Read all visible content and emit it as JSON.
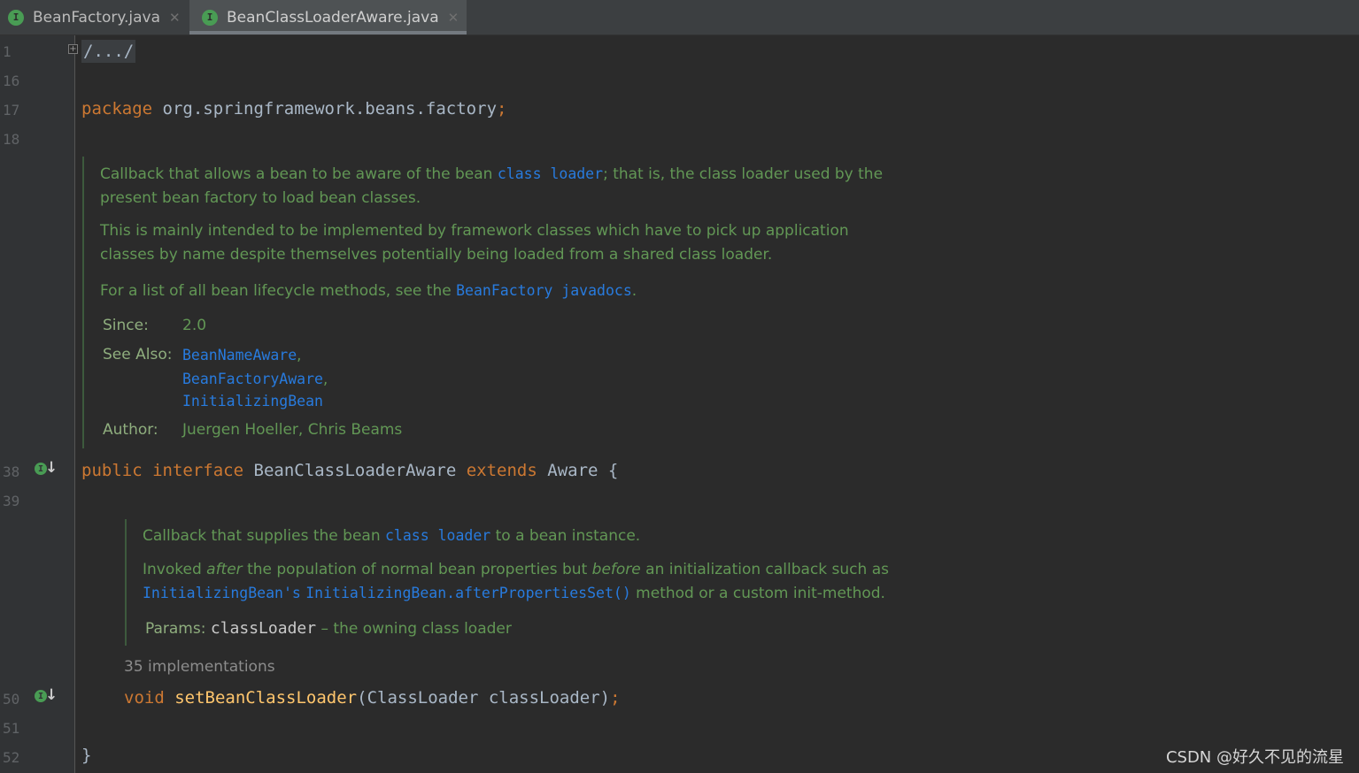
{
  "tabs": [
    {
      "label": "BeanFactory.java",
      "icon": "interface-icon",
      "active": false
    },
    {
      "label": "BeanClassLoaderAware.java",
      "icon": "interface-icon",
      "active": true
    }
  ],
  "gutter": {
    "line_numbers": [
      "1",
      "16",
      "17",
      "18",
      "38",
      "39",
      "50",
      "51",
      "52"
    ]
  },
  "code": {
    "collapsed_header": "/.../",
    "package_keyword": "package",
    "package_name": " org.springframework.beans.factory",
    "package_semicolon": ";",
    "interface_decl": {
      "kw_public": "public",
      "kw_interface": "interface",
      "name": "BeanClassLoaderAware",
      "kw_extends": "extends",
      "parent": "Aware",
      "brace": "{"
    },
    "method_decl": {
      "kw_void": "void",
      "name": "setBeanClassLoader",
      "params": "(ClassLoader classLoader)",
      "semicolon": ";"
    },
    "closing_brace": "}",
    "implementations_hint": "35 implementations"
  },
  "class_doc": {
    "p1_a": "Callback that allows a bean to be aware of the bean ",
    "p1_link": "class loader",
    "p1_b": "; that is, the class loader used by the",
    "p1_line2": "present bean factory to load bean classes.",
    "p2_line1": "This is mainly intended to be implemented by framework classes which have to pick up application",
    "p2_line2": "classes by name despite themselves potentially being loaded from a shared class loader.",
    "p3_a": "For a list of all bean lifecycle methods, see the ",
    "p3_link": "BeanFactory javadocs",
    "p3_b": ".",
    "since_label": "Since:",
    "since_value": "2.0",
    "see_also_label": "See Also:",
    "see_also": [
      "BeanNameAware",
      "BeanFactoryAware",
      "InitializingBean"
    ],
    "see_also_sep": ",",
    "author_label": "Author:",
    "author_value": "Juergen Hoeller, Chris Beams"
  },
  "method_doc": {
    "p1_a": "Callback that supplies the bean ",
    "p1_link": "class loader",
    "p1_b": " to a bean instance.",
    "p2_a": "Invoked ",
    "p2_em1": "after",
    "p2_b": " the population of normal bean properties but ",
    "p2_em2": "before",
    "p2_c": " an initialization callback such as",
    "p2_link1": "InitializingBean's",
    "p2_link2": "InitializingBean.afterPropertiesSet()",
    "p2_d": " method or a custom init-method.",
    "params_label": "Params:",
    "param_name": "classLoader",
    "param_desc": " – the owning class loader"
  },
  "watermark": "CSDN @好久不见的流星",
  "colors": {
    "editor_bg": "#2b2b2b",
    "gutter_bg": "#313335",
    "keyword": "#cc7832",
    "function": "#ffc66d",
    "doc_text": "#629755",
    "doc_link": "#287bde",
    "code_text": "#a9b7c6",
    "interface_icon": "#499c54"
  }
}
